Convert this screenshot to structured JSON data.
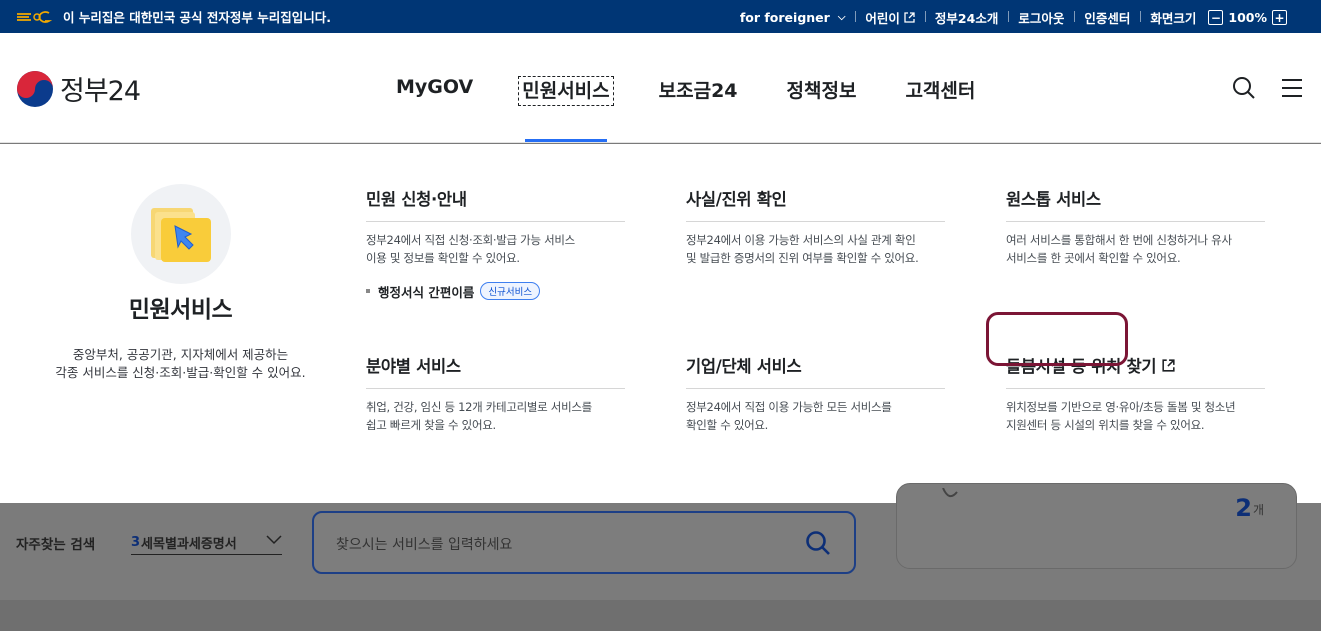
{
  "govbar": {
    "notice": "이 누리집은 대한민국 공식 전자정부 누리집입니다.",
    "foreigner": "for foreigner",
    "kids": "어린이",
    "about": "정부24소개",
    "logout": "로그아웃",
    "cert": "인증센터",
    "zoom_label": "화면크기",
    "zoom_minus": "−",
    "zoom_value": "100%",
    "zoom_plus": "+"
  },
  "header": {
    "logo_text": "정부24",
    "menus": [
      "MyGOV",
      "민원서비스",
      "보조금24",
      "정책정보",
      "고객센터"
    ],
    "active_menu": "민원서비스"
  },
  "mega": {
    "intro": {
      "title": "민원서비스",
      "desc_line1": "중앙부처, 공공기관, 지자체에서 제공하는",
      "desc_line2": "각종 서비스를 신청·조회·발급·확인할 수 있어요."
    },
    "cols": [
      {
        "title": "민원 신청·안내",
        "desc_line1": "정부24에서 직접 신청·조회·발급 가능 서비스",
        "desc_line2": "이용 및 정보를 확인할 수 있어요.",
        "sub_label": "행정서식 간편이름",
        "sub_badge": "신규서비스"
      },
      {
        "title": "사실/진위 확인",
        "desc_line1": "정부24에서 이용 가능한 서비스의 사실 관계 확인",
        "desc_line2": "및 발급한 증명서의 진위 여부를 확인할 수 있어요."
      },
      {
        "title": "원스톱 서비스",
        "desc_line1": "여러 서비스를 통합해서 한 번에 신청하거나 유사",
        "desc_line2": "서비스를 한 곳에서 확인할 수 있어요."
      },
      {
        "title": "분야별 서비스",
        "desc_line1": "취업, 건강, 임신 등 12개 카테고리별로 서비스를",
        "desc_line2": "쉽고 빠르게 찾을 수 있어요."
      },
      {
        "title": "기업/단체 서비스",
        "desc_line1": "정부24에서 직접 이용 가능한 모든 서비스를",
        "desc_line2": "확인할 수 있어요."
      },
      {
        "title": "돌봄시설 등 위치 찾기",
        "desc_line1": "위치정보를 기반으로 영·유아/초등 돌봄 및 청소년",
        "desc_line2": "지원센터 등 시설의 위치를 찾을 수 있어요."
      }
    ]
  },
  "under": {
    "frequent_label": "자주찾는 검색",
    "frequent_num": "3",
    "frequent_value": "세목별과세증명서",
    "search_placeholder": "찾으시는 서비스를 입력하세요",
    "card_count": "2",
    "card_unit": "개"
  },
  "colors": {
    "govbar_bg": "#003675",
    "accent": "#256ef4",
    "highlight": "#7b1535"
  }
}
